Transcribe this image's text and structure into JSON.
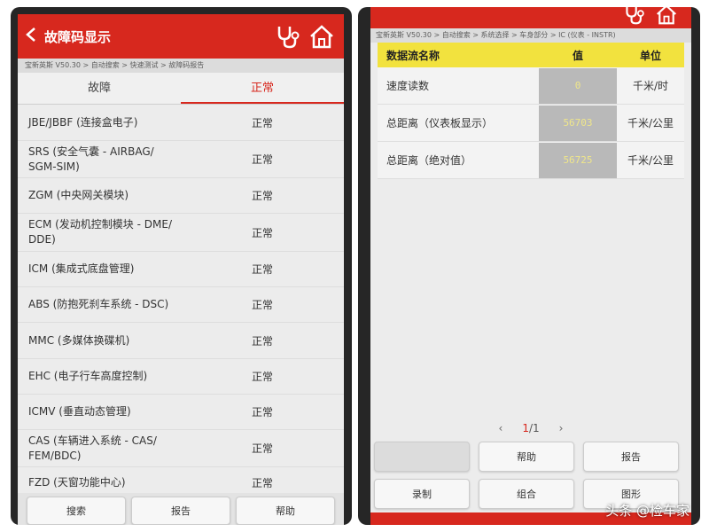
{
  "left": {
    "title": "故障码显示",
    "breadcrumb": "宝新英斯 V50.30 > 自动搜索 > 快速测试 > 故障码报告",
    "tabs": [
      {
        "label": "故障",
        "active": false
      },
      {
        "label": "正常",
        "active": true
      }
    ],
    "dtc_items": [
      {
        "name": "JBE/JBBF (连接盒电子)",
        "status": "正常"
      },
      {
        "name": "SRS (安全气囊 - AIRBAG/\nSGM-SIM)",
        "status": "正常"
      },
      {
        "name": "ZGM (中央网关模块)",
        "status": "正常"
      },
      {
        "name": "ECM (发动机控制模块 - DME/\nDDE)",
        "status": "正常"
      },
      {
        "name": "ICM (集成式底盘管理)",
        "status": "正常"
      },
      {
        "name": "ABS (防抱死刹车系统 - DSC)",
        "status": "正常"
      },
      {
        "name": "MMC (多媒体换碟机)",
        "status": "正常"
      },
      {
        "name": "EHC (电子行车高度控制)",
        "status": "正常"
      },
      {
        "name": "ICMV (垂直动态管理)",
        "status": "正常"
      },
      {
        "name": "CAS (车辆进入系统 - CAS/\nFEM/BDC)",
        "status": "正常"
      },
      {
        "name": "FZD (天窗功能中心)",
        "status": "正常"
      }
    ],
    "buttons": [
      "搜索",
      "报告",
      "帮助"
    ]
  },
  "right": {
    "breadcrumb": "宝新英斯 V50.30 > 自动搜索 > 系统选择 > 车身部分 > IC (仪表 - INSTR)",
    "table_headers": {
      "name": "数据流名称",
      "value": "值",
      "unit": "单位"
    },
    "rows": [
      {
        "name": "速度读数",
        "value": "0",
        "unit": "千米/时"
      },
      {
        "name": "总距离（仪表板显示）",
        "value": "56703",
        "unit": "千米/公里"
      },
      {
        "name": "总距离（绝对值）",
        "value": "56725",
        "unit": "千米/公里"
      }
    ],
    "pager": {
      "current": "1",
      "total": "/1"
    },
    "buttons": [
      "",
      "帮助",
      "报告",
      "录制",
      "组合",
      "图形"
    ]
  },
  "watermark": "头条 @检车家",
  "colors": {
    "brand_red": "#d7281e",
    "header_yellow": "#f2e23e",
    "value_bg": "#b9b9b9",
    "value_text": "#efe68a"
  }
}
